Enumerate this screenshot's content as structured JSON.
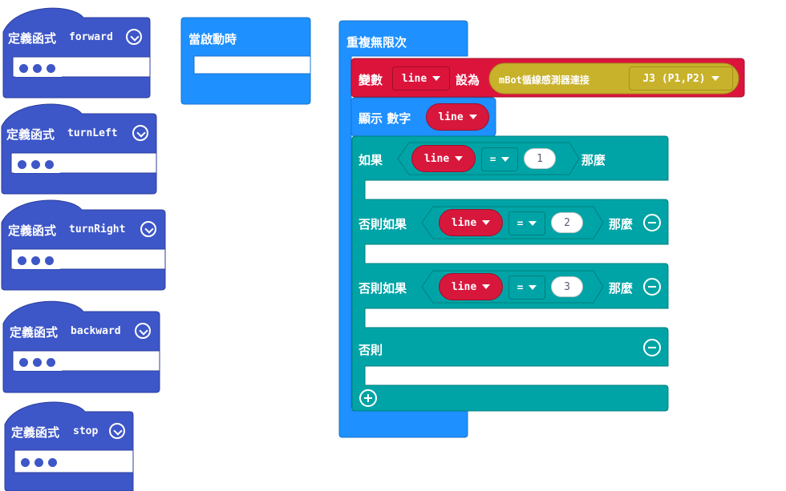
{
  "functions": [
    {
      "prefix": "定義函式",
      "name": "forward"
    },
    {
      "prefix": "定義函式",
      "name": "turnLeft"
    },
    {
      "prefix": "定義函式",
      "name": "turnRight"
    },
    {
      "prefix": "定義函式",
      "name": "backward"
    },
    {
      "prefix": "定義函式",
      "name": "stop"
    }
  ],
  "on_start": {
    "label": "當啟動時"
  },
  "forever": {
    "label": "重複無限次",
    "set_var": {
      "label": "變數",
      "var": "line",
      "to_label": "設為",
      "sensor_label": "mBot循線感測器連接",
      "port": "J3 (P1,P2)"
    },
    "show_number": {
      "label": "顯示 數字",
      "var": "line"
    },
    "if_block": {
      "if_label": "如果",
      "then_label": "那麼",
      "elseif_label": "否則如果",
      "else_label": "否則",
      "conditions": [
        {
          "var": "line",
          "op": "=",
          "value": "1"
        },
        {
          "var": "line",
          "op": "=",
          "value": "2"
        },
        {
          "var": "line",
          "op": "=",
          "value": "3"
        }
      ]
    }
  },
  "colors": {
    "functions": "#3d56c8",
    "basic": "#1e90ff",
    "variables": "#dc143c",
    "logic": "#00a4a6",
    "sensor": "#c8b22b"
  }
}
